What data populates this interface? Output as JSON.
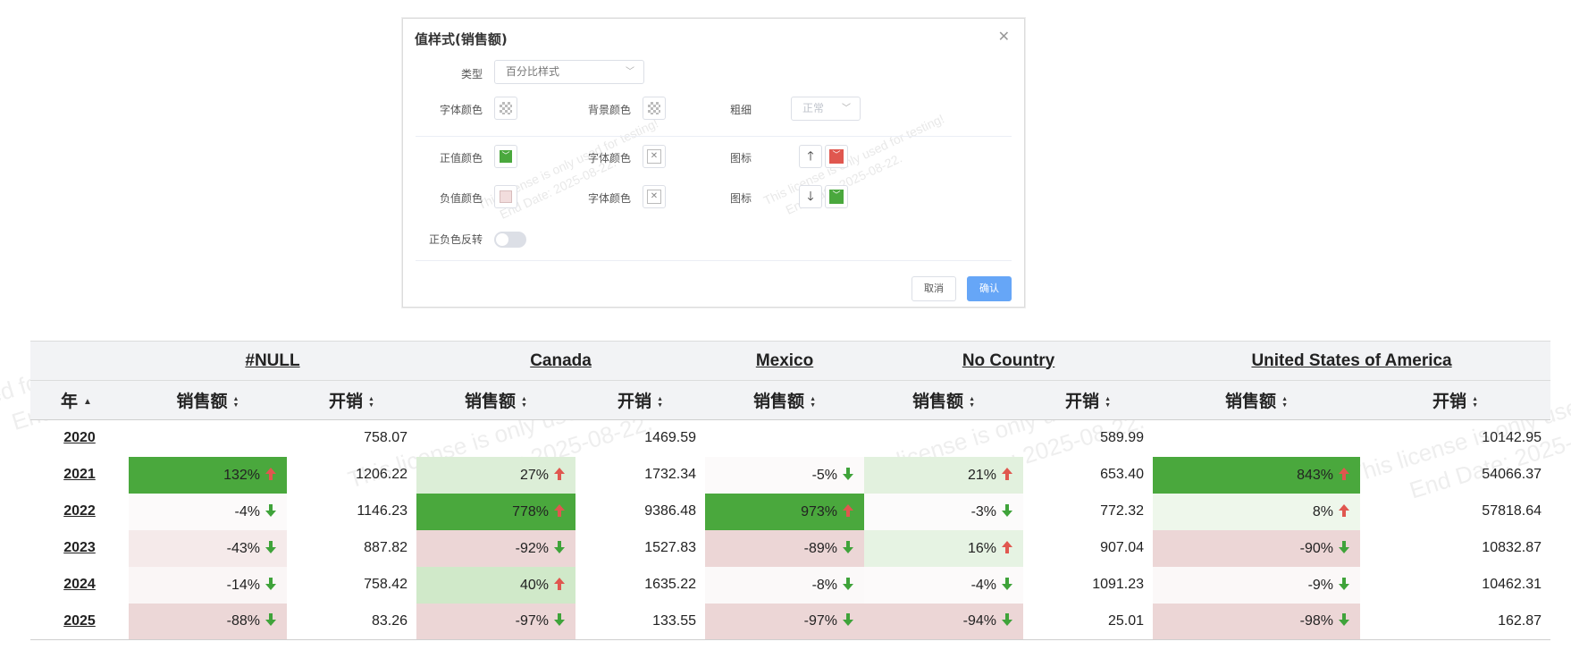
{
  "dialog": {
    "title": "值样式(销售额)",
    "type_label": "类型",
    "type_value": "百分比样式",
    "font_color_label": "字体颜色",
    "bg_color_label": "背景颜色",
    "weight_label": "粗细",
    "weight_value": "正常",
    "pos_color_label": "正值颜色",
    "pos_font_color_label": "字体颜色",
    "pos_icon_label": "图标",
    "neg_color_label": "负值颜色",
    "neg_font_color_label": "字体颜色",
    "neg_icon_label": "图标",
    "invert_label": "正负色反转",
    "cancel_label": "取消",
    "confirm_label": "确认",
    "colors": {
      "positive": "#4aa83d",
      "negative": "#f2dddd",
      "icon_up_bg": "#e0574f",
      "icon_down_bg": "#4aa83d"
    }
  },
  "watermark": {
    "line1": "This license is only used for testing!",
    "line2": "End Date: 2025-08-22."
  },
  "table": {
    "year_header": "年",
    "countries": [
      "#NULL",
      "Canada",
      "Mexico",
      "No Country",
      "United States of America"
    ],
    "sub_headers": [
      "销售额",
      "开销",
      "销售额",
      "开销",
      "销售额",
      "销售额",
      "开销",
      "销售额",
      "开销"
    ],
    "rows": [
      {
        "year": "2020",
        "cells": [
          "",
          "758.07",
          "",
          "1469.59",
          "",
          "",
          "589.99",
          "",
          "10142.95"
        ]
      },
      {
        "year": "2021",
        "cells": [
          "132%",
          "1206.22",
          "27%",
          "1732.34",
          "-5%",
          "21%",
          "653.40",
          "843%",
          "54066.37"
        ]
      },
      {
        "year": "2022",
        "cells": [
          "-4%",
          "1146.23",
          "778%",
          "9386.48",
          "973%",
          "-3%",
          "772.32",
          "8%",
          "57818.64"
        ]
      },
      {
        "year": "2023",
        "cells": [
          "-43%",
          "887.82",
          "-92%",
          "1527.83",
          "-89%",
          "16%",
          "907.04",
          "-90%",
          "10832.87"
        ]
      },
      {
        "year": "2024",
        "cells": [
          "-14%",
          "758.42",
          "40%",
          "1635.22",
          "-8%",
          "-4%",
          "1091.23",
          "-9%",
          "10462.31"
        ]
      },
      {
        "year": "2025",
        "cells": [
          "-88%",
          "83.26",
          "-97%",
          "133.55",
          "-97%",
          "-94%",
          "25.01",
          "-98%",
          "162.87"
        ]
      }
    ],
    "colors": {
      "up_arrow": "#e0574f",
      "down_arrow": "#3fa33a",
      "pos_max": "#4aa83d",
      "neg_max": "#ecd6d6"
    }
  }
}
